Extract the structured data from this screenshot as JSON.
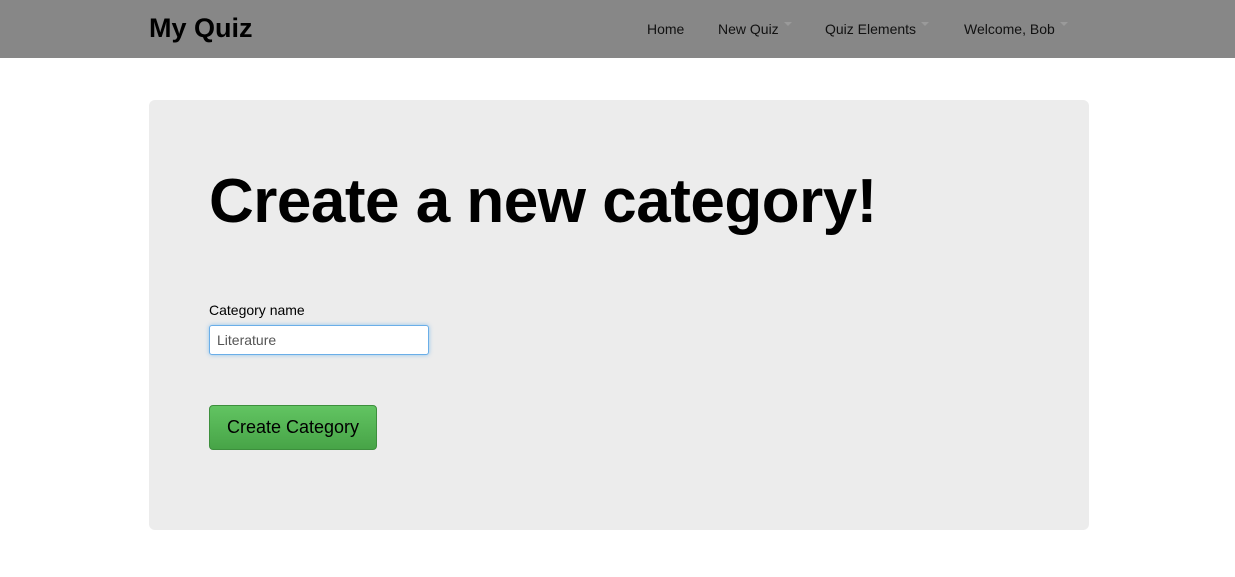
{
  "navbar": {
    "brand": "My Quiz",
    "items": [
      {
        "label": "Home",
        "dropdown": false
      },
      {
        "label": "New Quiz",
        "dropdown": true
      },
      {
        "label": "Quiz Elements",
        "dropdown": true
      },
      {
        "label": "Welcome, Bob",
        "dropdown": true
      }
    ],
    "background_color": "#878787"
  },
  "main": {
    "heading": "Create a new category!",
    "form": {
      "category_label": "Category name",
      "category_value": "Literature",
      "submit_label": "Create Category"
    },
    "panel_color": "#ececec",
    "button_color": "#5cb85c"
  }
}
